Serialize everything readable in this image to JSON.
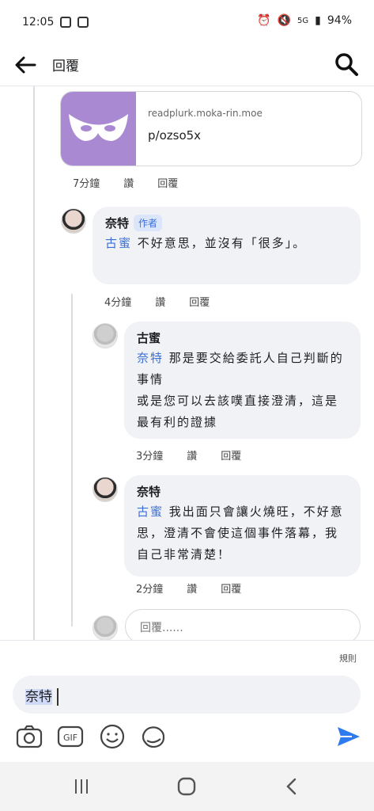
{
  "status_bar": {
    "time": "12:05",
    "network": "5G",
    "battery": "94%"
  },
  "app_bar": {
    "title": "回覆"
  },
  "link_card": {
    "domain": "readplurk.moka-rin.moe",
    "path": "p/ozso5x"
  },
  "actions_labels": {
    "like": "讚",
    "reply": "回覆"
  },
  "comments": [
    {
      "time": "7分鐘"
    },
    {
      "author": "奈特",
      "badge": "作者",
      "mention": "古蜜",
      "text": " 不好意思，並沒有「很多」。",
      "time": "4分鐘"
    },
    {
      "author": "古蜜",
      "mention": "奈特",
      "text": " 那是要交給委託人自己判斷的事情",
      "text2": "或是您可以去該噗直接澄清，這是最有利的證據",
      "time": "3分鐘"
    },
    {
      "author": "奈特",
      "mention": "古蜜",
      "text": " 我出面只會讓火燒旺，不好意思，澄清不會使這個事件落幕，我自己非常清楚！",
      "time": "2分鐘"
    }
  ],
  "reply_placeholder": "回覆......",
  "composer": {
    "rules_label": "規則",
    "value": "奈特"
  },
  "colors": {
    "accent": "#3b6fd8",
    "thumb": "#a98ad2",
    "send": "#2e7bf0"
  },
  "icons": [
    "back-arrow-icon",
    "search-icon",
    "mask-icon",
    "camera-icon",
    "gif-icon",
    "emoji-icon",
    "sticker-icon",
    "send-icon",
    "recent-apps-icon",
    "home-icon",
    "back-icon"
  ]
}
